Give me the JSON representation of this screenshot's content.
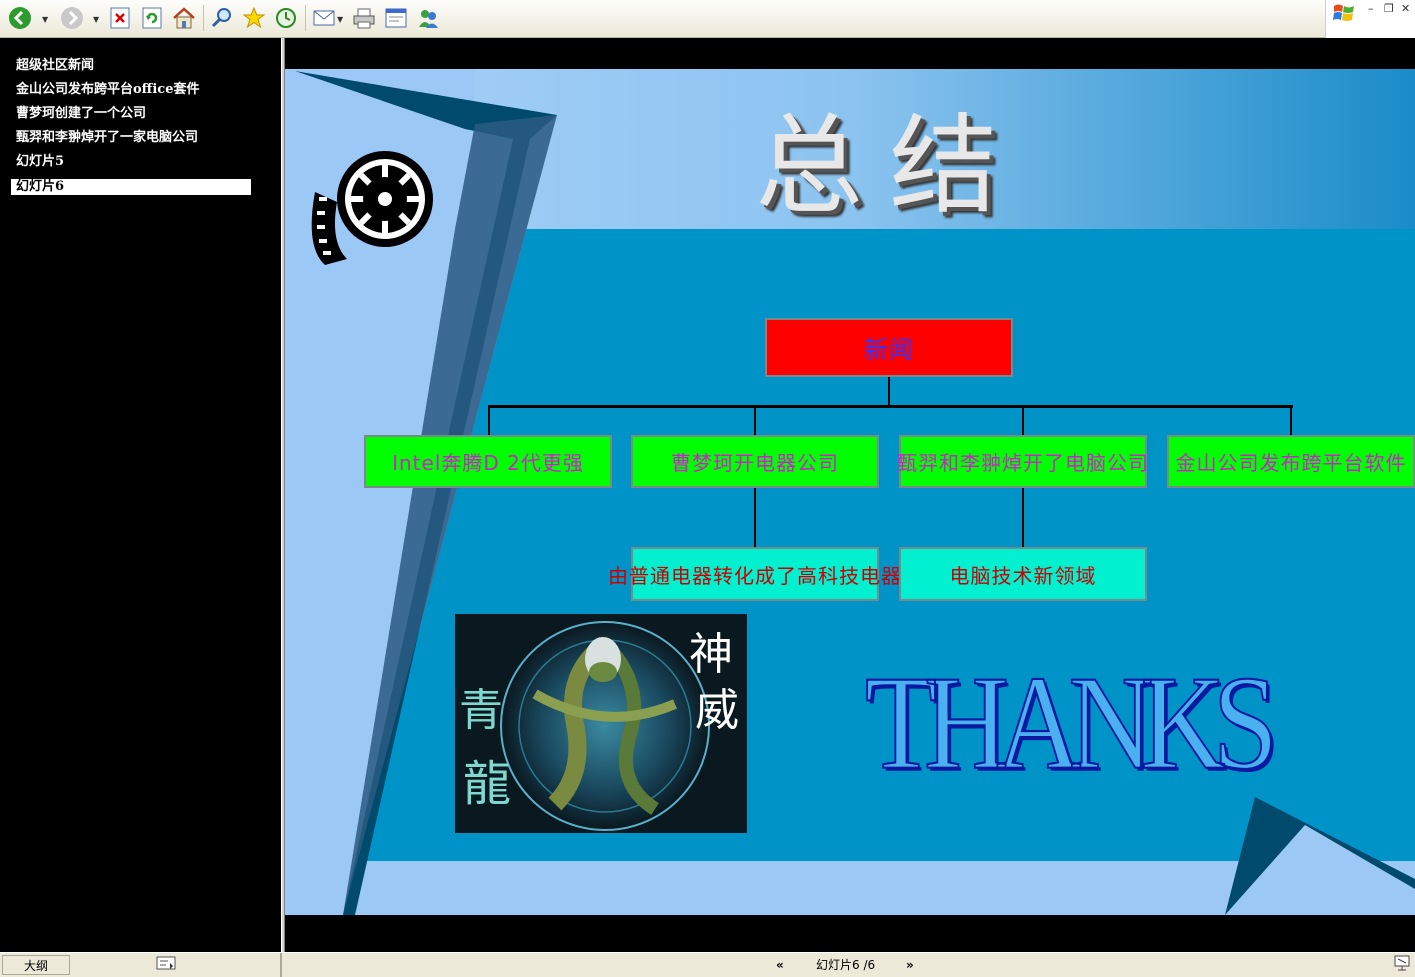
{
  "toolbar": {
    "buttons": [
      {
        "name": "back-icon"
      },
      {
        "name": "forward-icon"
      },
      {
        "name": "stop-icon"
      },
      {
        "name": "refresh-icon"
      },
      {
        "name": "home-icon"
      },
      {
        "name": "search-icon"
      },
      {
        "name": "favorites-icon"
      },
      {
        "name": "history-icon"
      },
      {
        "name": "mail-icon"
      },
      {
        "name": "print-icon"
      },
      {
        "name": "edit-icon"
      },
      {
        "name": "messenger-icon"
      }
    ]
  },
  "outline": {
    "items": [
      {
        "label": "超级社区新闻"
      },
      {
        "label": "金山公司发布跨平台office套件"
      },
      {
        "label": "曹梦珂创建了一个公司"
      },
      {
        "label": "甄羿和李翀焯开了一家电脑公司"
      },
      {
        "label": "幻灯片5"
      },
      {
        "label": "幻灯片6",
        "selected": true
      }
    ]
  },
  "slide": {
    "title": "总 结",
    "org_chart": {
      "root": "新闻",
      "level1": [
        "Intel奔腾D 2代更强",
        "曹梦珂开电器公司",
        "甄羿和李翀焯开了电脑公司",
        "金山公司发布跨平台软件"
      ],
      "level2": [
        "由普通电器转化成了高科技电器",
        "电脑技术新领域"
      ]
    },
    "dragon_image": {
      "text1": "神",
      "text2": "威",
      "text3": "青",
      "text4": "龍"
    },
    "thanks": "THANKS"
  },
  "statusbar": {
    "outline_tab": "大纲",
    "slide_indicator": "幻灯片6 /6",
    "prev": "«",
    "next": "»"
  },
  "colors": {
    "slide_bg_light": "#9cc8f6",
    "slide_bg_dark": "#0093c8",
    "root_box": "#ff0000",
    "level1_box": "#00ff00",
    "level2_box": "#00f0d0"
  }
}
